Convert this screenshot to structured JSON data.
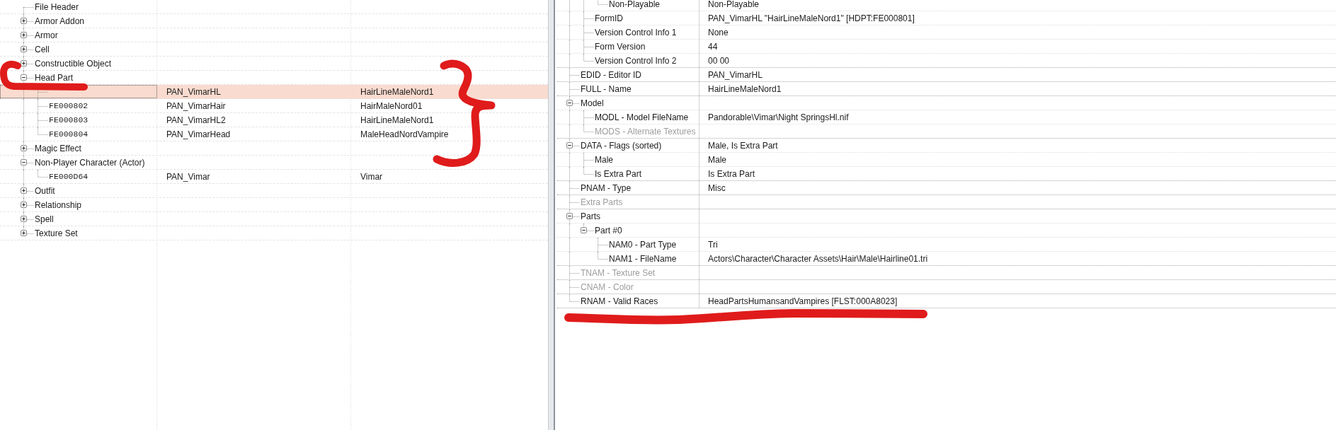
{
  "record_tree": {
    "items": [
      {
        "label": "File Header",
        "selected": false
      },
      {
        "label": "Armor Addon",
        "expanded": false,
        "selected": false
      },
      {
        "label": "Armor",
        "expanded": false,
        "selected": false
      },
      {
        "label": "Cell",
        "expanded": false,
        "selected": false
      },
      {
        "label": "Constructible Object",
        "expanded": false,
        "selected": false
      },
      {
        "label": "Head Part",
        "expanded": true,
        "selected": false,
        "children": [
          {
            "editor_id": "PAN_VimarHL",
            "name": "HairLineMaleNord1",
            "selected": true
          },
          {
            "form_id": "FE000802",
            "editor_id": "PAN_VimarHair",
            "name": "HairMaleNord01",
            "selected": false
          },
          {
            "form_id": "FE000803",
            "editor_id": "PAN_VimarHL2",
            "name": "HairLineMaleNord1",
            "selected": false
          },
          {
            "form_id": "FE000804",
            "editor_id": "PAN_VimarHead",
            "name": "MaleHeadNordVampire",
            "selected": false
          }
        ]
      },
      {
        "label": "Magic Effect",
        "expanded": false,
        "selected": false
      },
      {
        "label": "Non-Player Character (Actor)",
        "expanded": true,
        "selected": false,
        "children": [
          {
            "form_id": "FE000D64",
            "editor_id": "PAN_Vimar",
            "name": "Vimar",
            "selected": false
          }
        ]
      },
      {
        "label": "Outfit",
        "expanded": false,
        "selected": false
      },
      {
        "label": "Relationship",
        "expanded": false,
        "selected": false
      },
      {
        "label": "Spell",
        "expanded": false,
        "selected": false
      },
      {
        "label": "Texture Set",
        "expanded": false,
        "selected": false
      }
    ]
  },
  "record_view": {
    "rows": [
      {
        "children": [
          {
            "children": [
              {
                "label": "Non-Playable",
                "value": "Non-Playable",
                "disabled": false
              }
            ]
          },
          {
            "label": "FormID",
            "value": "PAN_VimarHL \"HairLineMaleNord1\" [HDPT:FE000801]",
            "disabled": false
          },
          {
            "label": "Version Control Info 1",
            "value": "None",
            "disabled": false
          },
          {
            "label": "Form Version",
            "value": "44",
            "disabled": false
          },
          {
            "label": "Version Control Info 2",
            "value": "00 00",
            "disabled": false
          }
        ]
      },
      {
        "label": "EDID - Editor ID",
        "value": "PAN_VimarHL",
        "disabled": false
      },
      {
        "label": "FULL - Name",
        "value": "HairLineMaleNord1",
        "disabled": false
      },
      {
        "label": "Model",
        "expanded": true,
        "disabled": false,
        "children": [
          {
            "label": "MODL - Model FileName",
            "value": "Pandorable\\Vimar\\Night SpringsHl.nif",
            "disabled": false
          },
          {
            "label": "MODS - Alternate Textures",
            "disabled": true
          }
        ]
      },
      {
        "label": "DATA - Flags (sorted)",
        "value": "Male, Is Extra Part",
        "expanded": true,
        "disabled": false,
        "children": [
          {
            "label": "Male",
            "value": "Male",
            "disabled": false
          },
          {
            "label": "Is Extra Part",
            "value": "Is Extra Part",
            "disabled": false
          }
        ]
      },
      {
        "label": "PNAM - Type",
        "value": "Misc",
        "disabled": false
      },
      {
        "label": "Extra Parts",
        "disabled": true
      },
      {
        "label": "Parts",
        "expanded": true,
        "disabled": false,
        "children": [
          {
            "label": "Part #0",
            "expanded": true,
            "disabled": false,
            "children": [
              {
                "label": "NAM0 - Part Type",
                "value": "Tri",
                "disabled": false
              },
              {
                "label": "NAM1 - FileName",
                "value": "Actors\\Character\\Character Assets\\Hair\\Male\\Hairline01.tri",
                "disabled": false
              }
            ]
          }
        ]
      },
      {
        "label": "TNAM - Texture Set",
        "disabled": true
      },
      {
        "label": "CNAM - Color",
        "disabled": true
      },
      {
        "label": "RNAM - Valid Races",
        "value": "HeadPartsHumansandVampires [FLST:000A8023]",
        "disabled": false
      }
    ]
  }
}
